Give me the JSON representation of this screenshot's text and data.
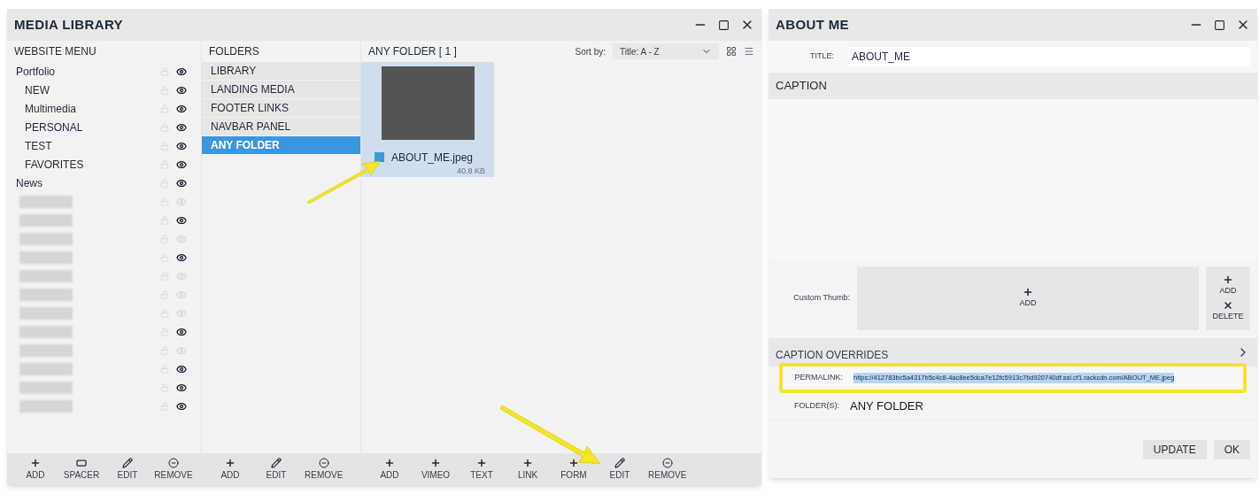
{
  "library": {
    "title": "MEDIA LIBRARY",
    "menu": {
      "heading": "WEBSITE MENU",
      "items": [
        {
          "kind": "page",
          "label": "Portfolio",
          "visible": true,
          "children": [
            {
              "kind": "page",
              "label": "NEW",
              "visible": true
            },
            {
              "kind": "page",
              "label": "Multimedia",
              "visible": true
            },
            {
              "kind": "page",
              "label": "PERSONAL",
              "visible": true
            },
            {
              "kind": "page",
              "label": "TEST",
              "visible": true
            },
            {
              "kind": "page",
              "label": "FAVORITES",
              "visible": true
            }
          ]
        },
        {
          "kind": "page",
          "label": "News",
          "visible": true
        },
        {
          "kind": "redacted",
          "visible": false
        },
        {
          "kind": "redacted",
          "visible": true
        },
        {
          "kind": "redacted",
          "visible": false
        },
        {
          "kind": "redacted",
          "visible": true
        },
        {
          "kind": "redacted",
          "visible": false
        },
        {
          "kind": "redacted",
          "visible": false
        },
        {
          "kind": "redacted",
          "visible": false
        },
        {
          "kind": "redacted",
          "visible": true
        },
        {
          "kind": "redacted",
          "visible": false
        },
        {
          "kind": "redacted",
          "visible": true
        },
        {
          "kind": "redacted",
          "visible": true
        },
        {
          "kind": "redacted",
          "visible": true
        }
      ],
      "toolbar": [
        {
          "kind": "add",
          "label": "ADD"
        },
        {
          "kind": "spacer",
          "label": "SPACER"
        },
        {
          "kind": "edit",
          "label": "EDIT"
        },
        {
          "kind": "remove",
          "label": "REMOVE"
        }
      ]
    },
    "folders": {
      "heading": "FOLDERS",
      "items": [
        {
          "label": "LIBRARY",
          "selected": false
        },
        {
          "label": "LANDING MEDIA",
          "selected": false
        },
        {
          "label": "FOOTER LINKS",
          "selected": false
        },
        {
          "label": "NAVBAR PANEL",
          "selected": false
        },
        {
          "label": "ANY FOLDER",
          "selected": true
        }
      ],
      "toolbar": [
        {
          "kind": "add",
          "label": "ADD"
        },
        {
          "kind": "edit",
          "label": "EDIT"
        },
        {
          "kind": "remove",
          "label": "REMOVE"
        }
      ]
    },
    "files": {
      "heading": "ANY FOLDER [ 1 ]",
      "sort_label": "Sort by:",
      "sort_value": "Title: A - Z",
      "items": [
        {
          "name": "ABOUT_ME.jpeg",
          "size": "40.8 KB",
          "selected": true
        }
      ],
      "toolbar": [
        {
          "kind": "add",
          "label": "ADD"
        },
        {
          "kind": "add",
          "label": "VIMEO"
        },
        {
          "kind": "add",
          "label": "TEXT"
        },
        {
          "kind": "add",
          "label": "LINK"
        },
        {
          "kind": "add",
          "label": "FORM"
        },
        {
          "kind": "edit",
          "label": "EDIT"
        },
        {
          "kind": "remove",
          "label": "REMOVE"
        }
      ]
    }
  },
  "detail": {
    "title": "ABOUT ME",
    "title_label": "TITLE:",
    "title_value": "ABOUT_ME",
    "caption_heading": "CAPTION",
    "thumb_label": "Custom Thumb:",
    "thumb_add": "ADD",
    "thumb_buttons": [
      {
        "kind": "add",
        "label": "ADD"
      },
      {
        "kind": "delete",
        "label": "DELETE"
      }
    ],
    "overrides_heading": "CAPTION OVERRIDES",
    "permalink_label": "PERMALINK:",
    "permalink": "https://412783bc5a4317b5c4c8-4ac8ee5dca7e12fc5913c7bd920740df.ssl.cf1.rackcdn.com/ABOUT_ME.jpeg",
    "folders_label": "FOLDER(S):",
    "folders_value": "ANY FOLDER",
    "buttons": [
      "UPDATE",
      "OK"
    ]
  }
}
